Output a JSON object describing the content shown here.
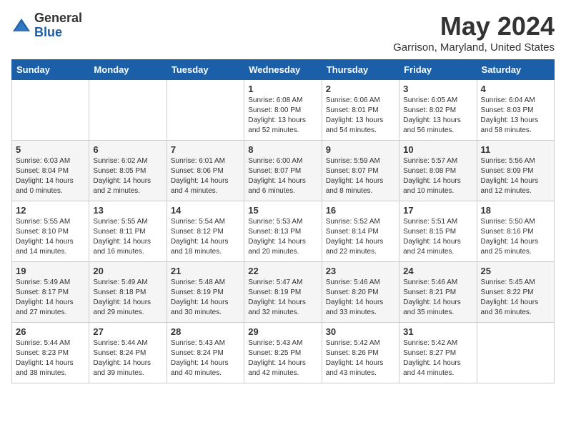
{
  "logo": {
    "general": "General",
    "blue": "Blue"
  },
  "title": "May 2024",
  "location": "Garrison, Maryland, United States",
  "days_of_week": [
    "Sunday",
    "Monday",
    "Tuesday",
    "Wednesday",
    "Thursday",
    "Friday",
    "Saturday"
  ],
  "weeks": [
    [
      {
        "day": "",
        "info": ""
      },
      {
        "day": "",
        "info": ""
      },
      {
        "day": "",
        "info": ""
      },
      {
        "day": "1",
        "info": "Sunrise: 6:08 AM\nSunset: 8:00 PM\nDaylight: 13 hours\nand 52 minutes."
      },
      {
        "day": "2",
        "info": "Sunrise: 6:06 AM\nSunset: 8:01 PM\nDaylight: 13 hours\nand 54 minutes."
      },
      {
        "day": "3",
        "info": "Sunrise: 6:05 AM\nSunset: 8:02 PM\nDaylight: 13 hours\nand 56 minutes."
      },
      {
        "day": "4",
        "info": "Sunrise: 6:04 AM\nSunset: 8:03 PM\nDaylight: 13 hours\nand 58 minutes."
      }
    ],
    [
      {
        "day": "5",
        "info": "Sunrise: 6:03 AM\nSunset: 8:04 PM\nDaylight: 14 hours\nand 0 minutes."
      },
      {
        "day": "6",
        "info": "Sunrise: 6:02 AM\nSunset: 8:05 PM\nDaylight: 14 hours\nand 2 minutes."
      },
      {
        "day": "7",
        "info": "Sunrise: 6:01 AM\nSunset: 8:06 PM\nDaylight: 14 hours\nand 4 minutes."
      },
      {
        "day": "8",
        "info": "Sunrise: 6:00 AM\nSunset: 8:07 PM\nDaylight: 14 hours\nand 6 minutes."
      },
      {
        "day": "9",
        "info": "Sunrise: 5:59 AM\nSunset: 8:07 PM\nDaylight: 14 hours\nand 8 minutes."
      },
      {
        "day": "10",
        "info": "Sunrise: 5:57 AM\nSunset: 8:08 PM\nDaylight: 14 hours\nand 10 minutes."
      },
      {
        "day": "11",
        "info": "Sunrise: 5:56 AM\nSunset: 8:09 PM\nDaylight: 14 hours\nand 12 minutes."
      }
    ],
    [
      {
        "day": "12",
        "info": "Sunrise: 5:55 AM\nSunset: 8:10 PM\nDaylight: 14 hours\nand 14 minutes."
      },
      {
        "day": "13",
        "info": "Sunrise: 5:55 AM\nSunset: 8:11 PM\nDaylight: 14 hours\nand 16 minutes."
      },
      {
        "day": "14",
        "info": "Sunrise: 5:54 AM\nSunset: 8:12 PM\nDaylight: 14 hours\nand 18 minutes."
      },
      {
        "day": "15",
        "info": "Sunrise: 5:53 AM\nSunset: 8:13 PM\nDaylight: 14 hours\nand 20 minutes."
      },
      {
        "day": "16",
        "info": "Sunrise: 5:52 AM\nSunset: 8:14 PM\nDaylight: 14 hours\nand 22 minutes."
      },
      {
        "day": "17",
        "info": "Sunrise: 5:51 AM\nSunset: 8:15 PM\nDaylight: 14 hours\nand 24 minutes."
      },
      {
        "day": "18",
        "info": "Sunrise: 5:50 AM\nSunset: 8:16 PM\nDaylight: 14 hours\nand 25 minutes."
      }
    ],
    [
      {
        "day": "19",
        "info": "Sunrise: 5:49 AM\nSunset: 8:17 PM\nDaylight: 14 hours\nand 27 minutes."
      },
      {
        "day": "20",
        "info": "Sunrise: 5:49 AM\nSunset: 8:18 PM\nDaylight: 14 hours\nand 29 minutes."
      },
      {
        "day": "21",
        "info": "Sunrise: 5:48 AM\nSunset: 8:19 PM\nDaylight: 14 hours\nand 30 minutes."
      },
      {
        "day": "22",
        "info": "Sunrise: 5:47 AM\nSunset: 8:19 PM\nDaylight: 14 hours\nand 32 minutes."
      },
      {
        "day": "23",
        "info": "Sunrise: 5:46 AM\nSunset: 8:20 PM\nDaylight: 14 hours\nand 33 minutes."
      },
      {
        "day": "24",
        "info": "Sunrise: 5:46 AM\nSunset: 8:21 PM\nDaylight: 14 hours\nand 35 minutes."
      },
      {
        "day": "25",
        "info": "Sunrise: 5:45 AM\nSunset: 8:22 PM\nDaylight: 14 hours\nand 36 minutes."
      }
    ],
    [
      {
        "day": "26",
        "info": "Sunrise: 5:44 AM\nSunset: 8:23 PM\nDaylight: 14 hours\nand 38 minutes."
      },
      {
        "day": "27",
        "info": "Sunrise: 5:44 AM\nSunset: 8:24 PM\nDaylight: 14 hours\nand 39 minutes."
      },
      {
        "day": "28",
        "info": "Sunrise: 5:43 AM\nSunset: 8:24 PM\nDaylight: 14 hours\nand 40 minutes."
      },
      {
        "day": "29",
        "info": "Sunrise: 5:43 AM\nSunset: 8:25 PM\nDaylight: 14 hours\nand 42 minutes."
      },
      {
        "day": "30",
        "info": "Sunrise: 5:42 AM\nSunset: 8:26 PM\nDaylight: 14 hours\nand 43 minutes."
      },
      {
        "day": "31",
        "info": "Sunrise: 5:42 AM\nSunset: 8:27 PM\nDaylight: 14 hours\nand 44 minutes."
      },
      {
        "day": "",
        "info": ""
      }
    ]
  ]
}
